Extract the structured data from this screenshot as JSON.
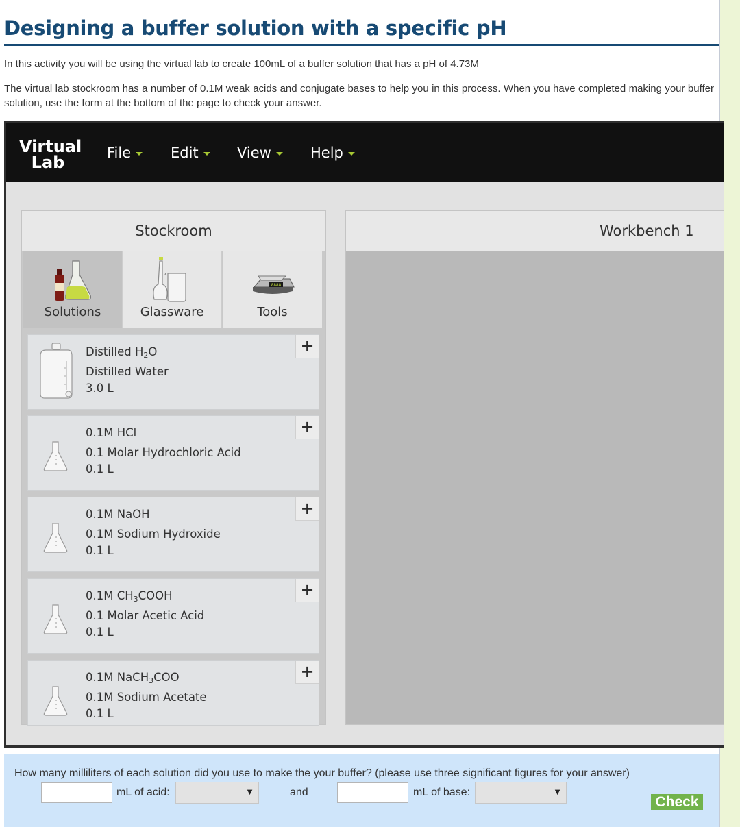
{
  "page": {
    "title": "Designing a buffer solution with a specific pH",
    "intro_1": "In this activity you will be using the virtual lab to create 100mL of a buffer solution that has a pH of 4.73M",
    "intro_2": "The virtual lab stockroom has a number of 0.1M weak acids and conjugate bases to help you in this process. When you have completed making your buffer solution, use the form at the bottom of the page to check your answer."
  },
  "lab": {
    "logo_line1": "Virtual",
    "logo_line2": "Lab",
    "menus": [
      "File",
      "Edit",
      "View",
      "Help"
    ],
    "stockroom_title": "Stockroom",
    "workbench_title": "Workbench 1",
    "tabs": [
      {
        "label": "Solutions",
        "icon": "solutions-icon",
        "active": true
      },
      {
        "label": "Glassware",
        "icon": "glassware-icon",
        "active": false
      },
      {
        "label": "Tools",
        "icon": "scale-icon",
        "active": false
      }
    ],
    "items": [
      {
        "formula_prefix": "Distilled H",
        "formula_sub": "2",
        "formula_suffix": "O",
        "name": "Distilled Water",
        "volume": "3.0 L",
        "icon": "water-jug-icon"
      },
      {
        "formula_prefix": "0.1M HCl",
        "formula_sub": "",
        "formula_suffix": "",
        "name": "0.1 Molar Hydrochloric Acid",
        "volume": "0.1 L",
        "icon": "flask-icon"
      },
      {
        "formula_prefix": "0.1M NaOH",
        "formula_sub": "",
        "formula_suffix": "",
        "name": "0.1M Sodium Hydroxide",
        "volume": "0.1 L",
        "icon": "flask-icon"
      },
      {
        "formula_prefix": "0.1M CH",
        "formula_sub": "3",
        "formula_suffix": "COOH",
        "name": "0.1 Molar Acetic Acid",
        "volume": "0.1 L",
        "icon": "flask-icon"
      },
      {
        "formula_prefix": "0.1M NaCH",
        "formula_sub": "3",
        "formula_suffix": "COO",
        "name": "0.1M Sodium Acetate",
        "volume": "0.1 L",
        "icon": "flask-icon"
      }
    ],
    "add_symbol": "+"
  },
  "form": {
    "question": "How many milliliters of each solution did you use to make the your buffer? (please use three significant figures for your answer)",
    "acid_value": "",
    "acid_label": "mL of acid:",
    "acid_select": "",
    "and_label": "and",
    "base_value": "",
    "base_label": "mL of base:",
    "base_select": "",
    "check_label": "Check"
  },
  "colors": {
    "title": "#174a74",
    "accent_caret": "#a7c833",
    "check": "#72b34c",
    "form_bg": "#cfe5fa"
  }
}
